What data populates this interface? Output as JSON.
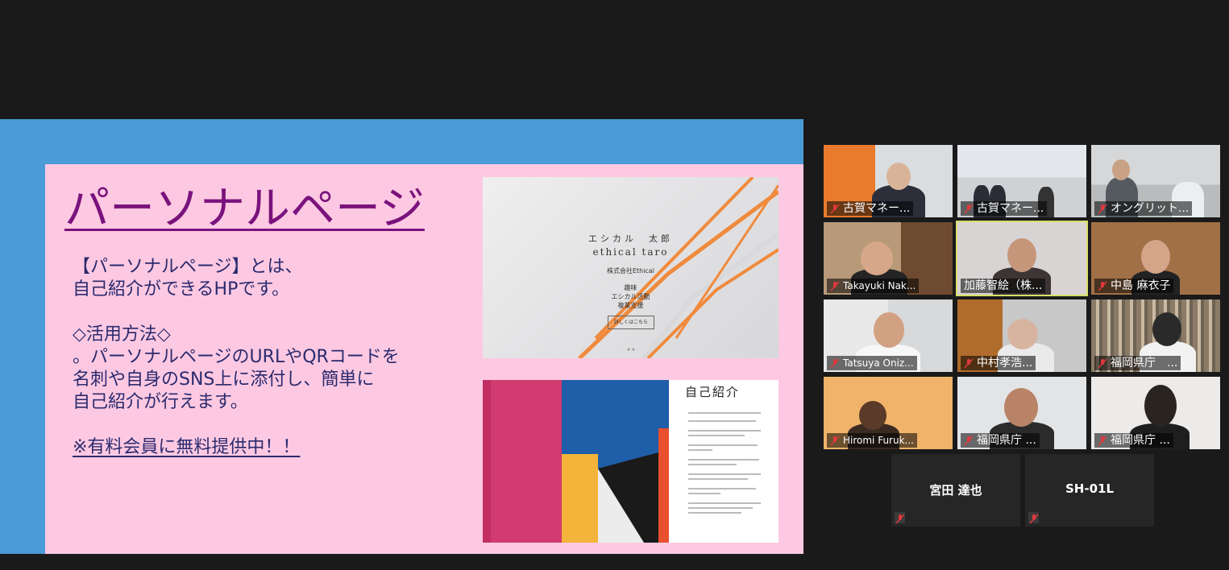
{
  "slide": {
    "title": "パーソナルページ",
    "intro": "【パーソナルページ】とは、\n自己紹介ができるHPです。",
    "usage": "◇活用方法◇\n。パーソナルページのURLやQRコードを\n名刺や自身のSNS上に添付し、簡単に\n自己紹介が行えます。",
    "notice": "※有料会員に無料提供中！！",
    "site1": {
      "name_jp": "エシカル　太郎",
      "name_en": "ethical taro",
      "company": "株式会社Ethical",
      "hobby_label": "趣味",
      "hobby_1": "エシカル活動",
      "hobby_2": "複業支援",
      "button": "詳しくはこちら"
    },
    "site2": {
      "heading": "自己紹介"
    }
  },
  "participants": [
    {
      "name": "古賀マネー...",
      "muted": true
    },
    {
      "name": "古賀マネー...",
      "muted": true
    },
    {
      "name": "オングリット...",
      "muted": true
    },
    {
      "name": "Takayuki Nak...",
      "muted": true
    },
    {
      "name": "加藤智絵（株...",
      "muted": false,
      "active_speaker": true
    },
    {
      "name": "中島 麻衣子",
      "muted": true
    },
    {
      "name": "Tatsuya Oniz...",
      "muted": true
    },
    {
      "name": "中村孝浩...",
      "muted": true
    },
    {
      "name": "福岡県庁　...",
      "muted": true
    },
    {
      "name": "Hiromi Furuk...",
      "muted": true
    },
    {
      "name": "福岡県庁 ...",
      "muted": true
    },
    {
      "name": "福岡県庁 ...",
      "muted": true
    }
  ],
  "audio_only": [
    {
      "name": "宮田 達也",
      "muted": true
    },
    {
      "name": "SH-01L",
      "muted": true
    }
  ],
  "colors": {
    "background": "#1a1a1a",
    "share_frame": "#4a9bd8",
    "slide_bg": "#fdc9e2",
    "title": "#7a127c",
    "body_text": "#2a2a6e",
    "active_speaker_border": "#d8e06a",
    "muted_icon": "#e0393e"
  },
  "icons": {
    "muted": "muted-mic-icon"
  }
}
